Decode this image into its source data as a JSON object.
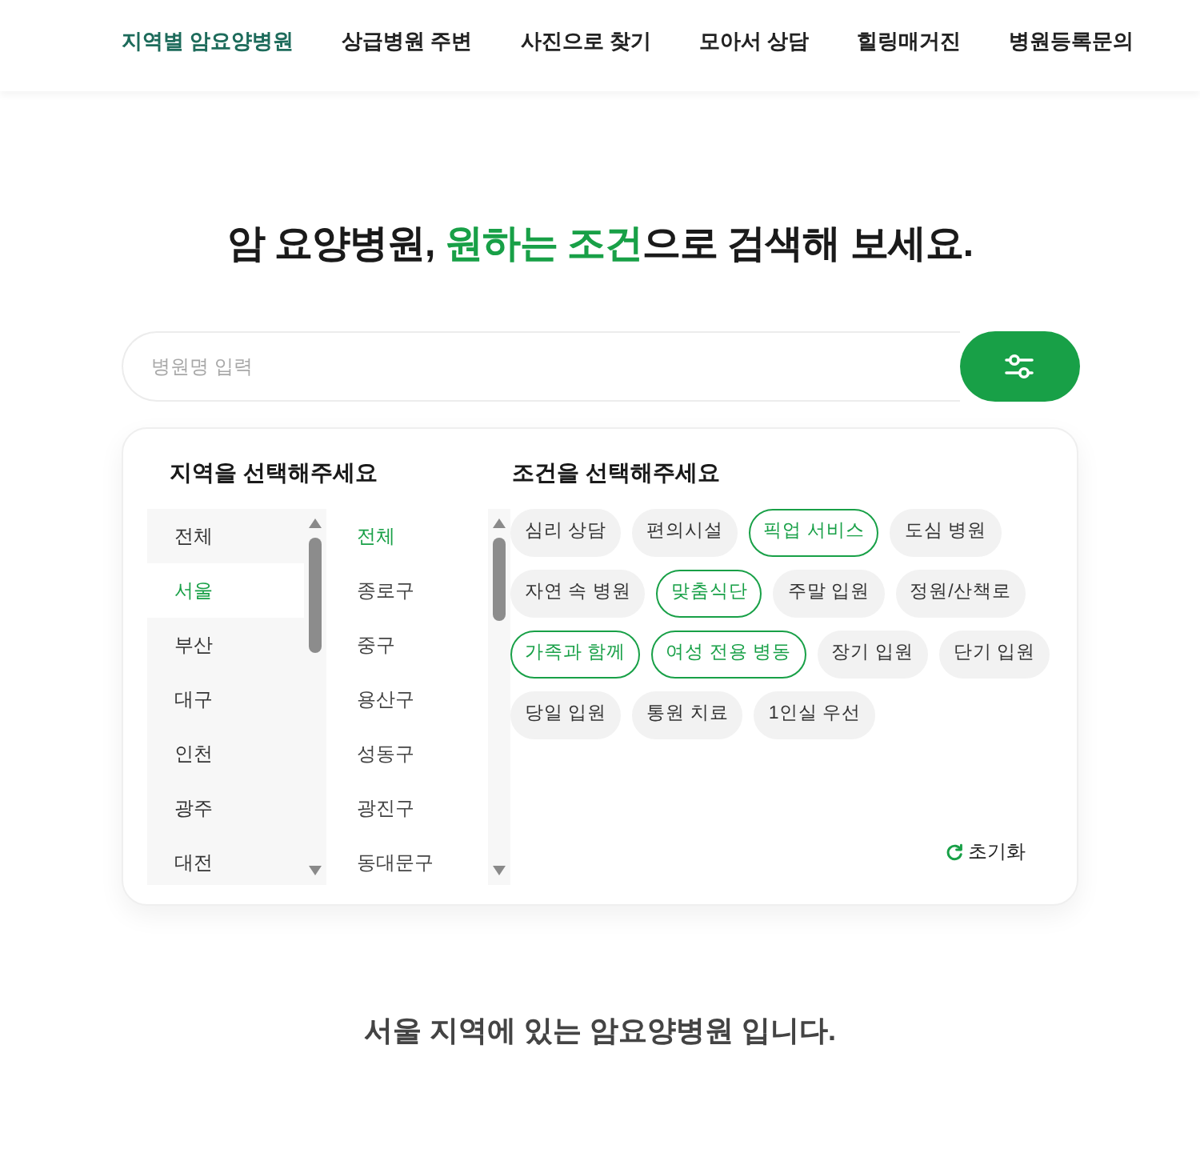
{
  "nav": {
    "items": [
      {
        "label": "지역별 암요양병원",
        "selected": true
      },
      {
        "label": "상급병원 주변",
        "selected": false
      },
      {
        "label": "사진으로 찾기",
        "selected": false
      },
      {
        "label": "모아서 상담",
        "selected": false
      },
      {
        "label": "힐링매거진",
        "selected": false
      },
      {
        "label": "병원등록문의",
        "selected": false
      }
    ]
  },
  "heading": {
    "parts": [
      {
        "text": "암 요양병원, ",
        "highlight": false
      },
      {
        "text": "원하는 조건",
        "highlight": true
      },
      {
        "text": "으로 검색해 보세요.",
        "highlight": false
      }
    ]
  },
  "search": {
    "placeholder": "병원명 입력"
  },
  "filter_panel": {
    "region_title": "지역을 선택해주세요",
    "regions": [
      {
        "label": "전체",
        "selected": false
      },
      {
        "label": "서울",
        "selected": true
      },
      {
        "label": "부산",
        "selected": false
      },
      {
        "label": "대구",
        "selected": false
      },
      {
        "label": "인천",
        "selected": false
      },
      {
        "label": "광주",
        "selected": false
      },
      {
        "label": "대전",
        "selected": false
      }
    ],
    "districts": [
      {
        "label": "전체",
        "selected": true
      },
      {
        "label": "종로구",
        "selected": false
      },
      {
        "label": "중구",
        "selected": false
      },
      {
        "label": "용산구",
        "selected": false
      },
      {
        "label": "성동구",
        "selected": false
      },
      {
        "label": "광진구",
        "selected": false
      },
      {
        "label": "동대문구",
        "selected": false
      }
    ],
    "condition_title": "조건을 선택해주세요",
    "conditions": [
      {
        "label": "심리 상담",
        "selected": false
      },
      {
        "label": "편의시설",
        "selected": false
      },
      {
        "label": "픽업 서비스",
        "selected": true
      },
      {
        "label": "도심 병원",
        "selected": false
      },
      {
        "label": "자연 속 병원",
        "selected": false
      },
      {
        "label": "맞춤식단",
        "selected": true
      },
      {
        "label": "주말 입원",
        "selected": false
      },
      {
        "label": "정원/산책로",
        "selected": false
      },
      {
        "label": "가족과 함께",
        "selected": true
      },
      {
        "label": "여성 전용 병동",
        "selected": true
      },
      {
        "label": "장기 입원",
        "selected": false
      },
      {
        "label": "단기 입원",
        "selected": false
      },
      {
        "label": "당일 입원",
        "selected": false
      },
      {
        "label": "통원 치료",
        "selected": false
      },
      {
        "label": "1인실 우선",
        "selected": false
      }
    ],
    "reset_label": "초기화"
  },
  "result_message": "서울 지역에 있는 암요양병원 입니다."
}
